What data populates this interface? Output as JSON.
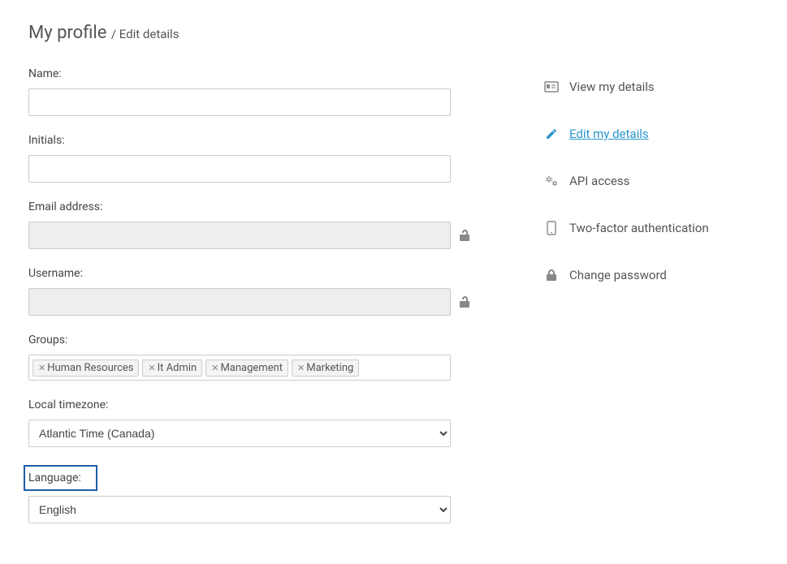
{
  "header": {
    "title": "My profile",
    "subtitle": "/ Edit details"
  },
  "fields": {
    "name": {
      "label": "Name:",
      "value": "",
      "placeholder": ""
    },
    "initials": {
      "label": "Initials:",
      "value": "",
      "placeholder": ""
    },
    "email": {
      "label": "Email address:",
      "value": "",
      "placeholder": "",
      "locked": true
    },
    "username": {
      "label": "Username:",
      "value": "",
      "placeholder": "",
      "locked": true
    },
    "groups": {
      "label": "Groups:",
      "tags": [
        "Human Resources",
        "It Admin",
        "Management",
        "Marketing"
      ]
    },
    "timezone": {
      "label": "Local timezone:",
      "value": "Atlantic Time (Canada)"
    },
    "language": {
      "label": "Language:",
      "value": "English"
    }
  },
  "sidebar": {
    "items": [
      {
        "label": "View my details",
        "icon": "card-icon"
      },
      {
        "label": "Edit my details",
        "icon": "pencil-icon",
        "active": true
      },
      {
        "label": "API access",
        "icon": "gears-icon"
      },
      {
        "label": "Two-factor authentication",
        "icon": "phone-icon"
      },
      {
        "label": "Change password",
        "icon": "lock-icon"
      }
    ]
  },
  "colors": {
    "accent": "#2996cc",
    "highlight": "#1e5fa8"
  }
}
